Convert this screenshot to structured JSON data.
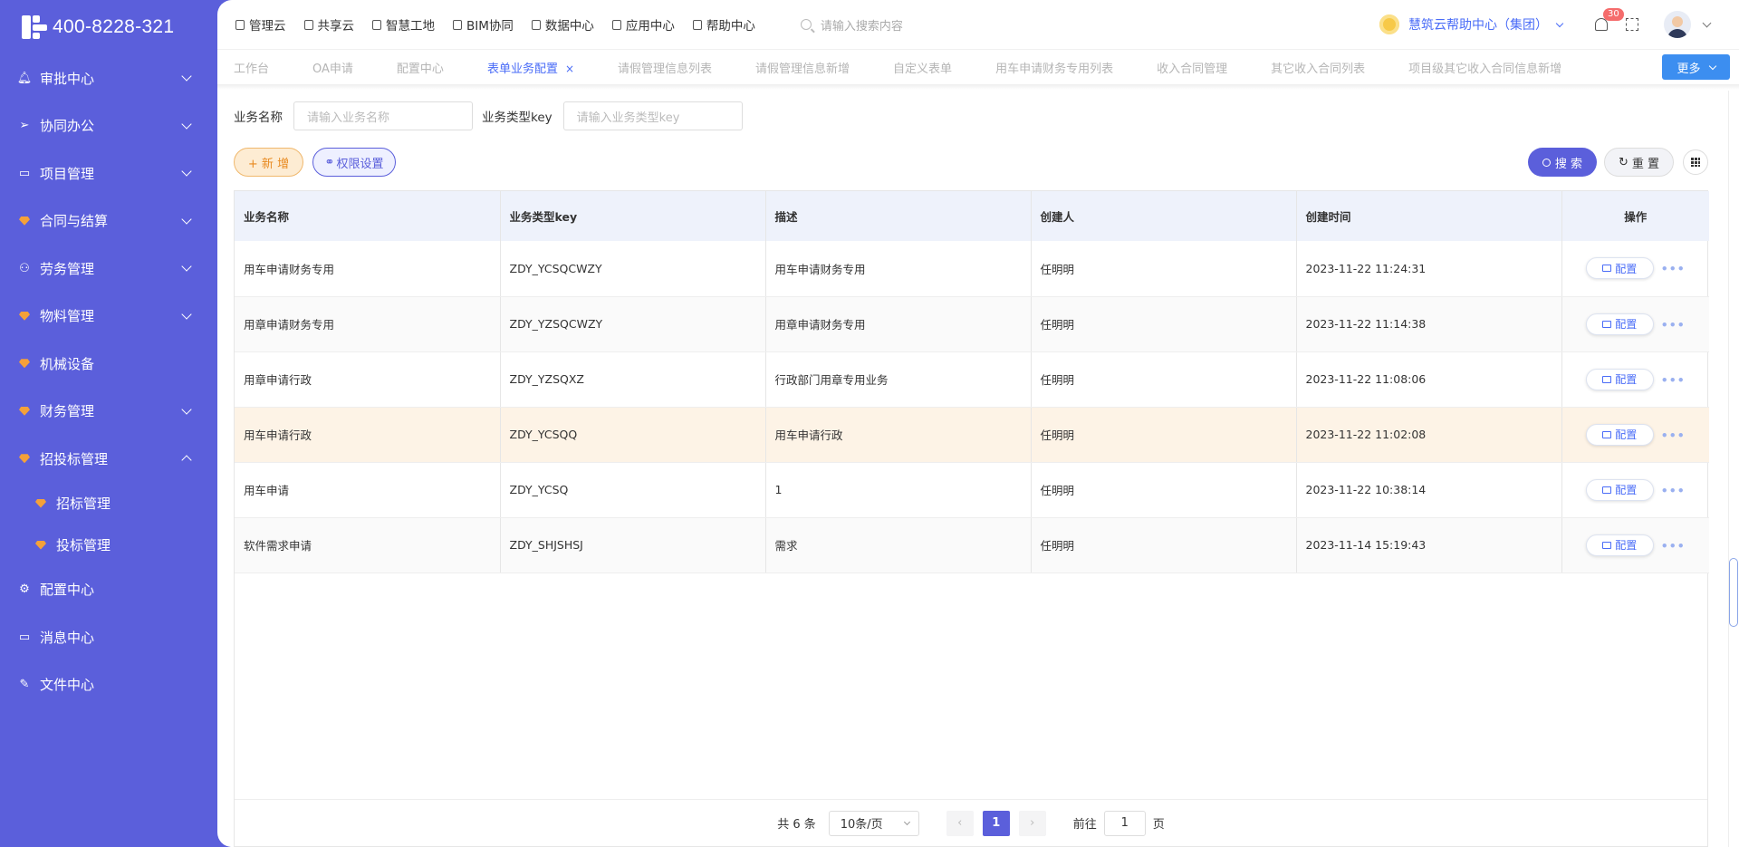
{
  "sidebar": {
    "logo_text": "400-8228-321",
    "items": [
      {
        "label": "审批中心",
        "icon": "bell-icon",
        "has_arrow": true
      },
      {
        "label": "协同办公",
        "icon": "send-icon",
        "has_arrow": true
      },
      {
        "label": "项目管理",
        "icon": "book-icon",
        "has_arrow": true
      },
      {
        "label": "合同与结算",
        "icon": "gem-icon",
        "has_arrow": true
      },
      {
        "label": "劳务管理",
        "icon": "users-icon",
        "has_arrow": true
      },
      {
        "label": "物料管理",
        "icon": "gem-icon",
        "has_arrow": true
      },
      {
        "label": "机械设备",
        "icon": "gem-icon",
        "has_arrow": false
      },
      {
        "label": "财务管理",
        "icon": "gem-icon",
        "has_arrow": true
      },
      {
        "label": "招投标管理",
        "icon": "gem-icon",
        "has_arrow": true,
        "expanded": true
      }
    ],
    "sub_items": [
      {
        "label": "招标管理",
        "icon": "gem-icon"
      },
      {
        "label": "投标管理",
        "icon": "gem-icon"
      }
    ],
    "bottom_items": [
      {
        "label": "配置中心",
        "icon": "gear-icon"
      },
      {
        "label": "消息中心",
        "icon": "message-icon"
      },
      {
        "label": "文件中心",
        "icon": "edit-file-icon"
      }
    ]
  },
  "topbar": {
    "nav": [
      "管理云",
      "共享云",
      "智慧工地",
      "BIM协同",
      "数据中心",
      "应用中心",
      "帮助中心"
    ],
    "search_placeholder": "请输入搜索内容",
    "help_center": "慧筑云帮助中心（集团）",
    "notification_count": "30"
  },
  "tabs": {
    "items": [
      "工作台",
      "OA申请",
      "配置中心",
      "表单业务配置",
      "请假管理信息列表",
      "请假管理信息新增",
      "自定义表单",
      "用车申请财务专用列表",
      "收入合同管理",
      "其它收入合同列表",
      "项目级其它收入合同信息新增"
    ],
    "active_index": 3,
    "close_symbol": "×",
    "more_label": "更多"
  },
  "filters": {
    "name_label": "业务名称",
    "name_placeholder": "请输入业务名称",
    "key_label": "业务类型key",
    "key_placeholder": "请输入业务类型key"
  },
  "actions": {
    "add_label": "+ 新 增",
    "perm_label": "权限设置",
    "search_label": "搜 索",
    "reset_label": "重 置"
  },
  "table": {
    "columns": [
      "业务名称",
      "业务类型key",
      "描述",
      "创建人",
      "创建时间",
      "操作"
    ],
    "config_label": "配置",
    "more_symbol": "•••",
    "rows": [
      {
        "name": "用车申请财务专用",
        "key": "ZDY_YCSQCWZY",
        "desc": "用车申请财务专用",
        "creator": "任明明",
        "time": "2023-11-22 11:24:31"
      },
      {
        "name": "用章申请财务专用",
        "key": "ZDY_YZSQCWZY",
        "desc": "用章申请财务专用",
        "creator": "任明明",
        "time": "2023-11-22 11:14:38"
      },
      {
        "name": "用章申请行政",
        "key": "ZDY_YZSQXZ",
        "desc": "行政部门用章专用业务",
        "creator": "任明明",
        "time": "2023-11-22 11:08:06"
      },
      {
        "name": "用车申请行政",
        "key": "ZDY_YCSQQ",
        "desc": "用车申请行政",
        "creator": "任明明",
        "time": "2023-11-22 11:02:08"
      },
      {
        "name": "用车申请",
        "key": "ZDY_YCSQ",
        "desc": "1",
        "creator": "任明明",
        "time": "2023-11-22 10:38:14"
      },
      {
        "name": "软件需求申请",
        "key": "ZDY_SHJSHSJ",
        "desc": "需求",
        "creator": "任明明",
        "time": "2023-11-14 15:19:43"
      }
    ],
    "highlight_row": 3
  },
  "pagination": {
    "total": "共 6 条",
    "page_size": "10条/页",
    "prev": "‹",
    "current": "1",
    "next": "›",
    "goto_label": "前往",
    "goto_value": "1",
    "page_suffix": "页"
  }
}
